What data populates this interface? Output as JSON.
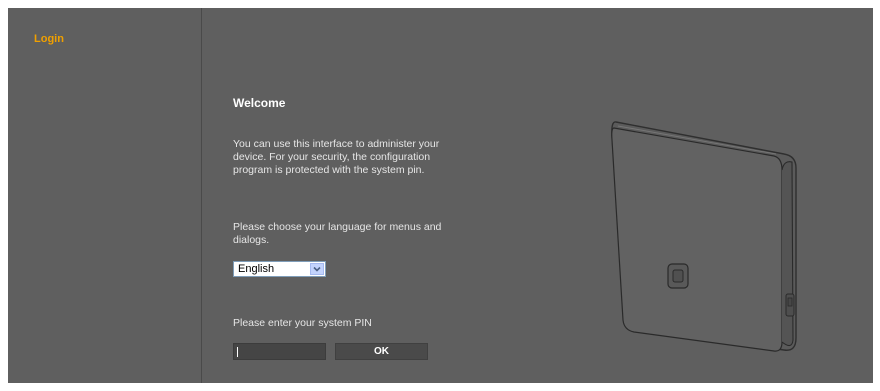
{
  "sidebar": {
    "items": [
      {
        "label": "Login",
        "active": true
      }
    ]
  },
  "main": {
    "heading": "Welcome",
    "description": "You can use this interface to administer your device. For your security, the configuration program is protected with the system pin.",
    "language_prompt": "Please choose your language for menus and dialogs.",
    "language_select": {
      "selected": "English",
      "icon": "chevron-down-icon"
    },
    "pin_prompt": "Please enter your system PIN",
    "pin_input": {
      "value": "",
      "placeholder": ""
    },
    "ok_label": "OK"
  },
  "colors": {
    "background": "#5f5f5f",
    "accent": "#f0a000",
    "text": "#ffffff"
  },
  "device_image": {
    "icon": "base-station-device-illustration"
  }
}
